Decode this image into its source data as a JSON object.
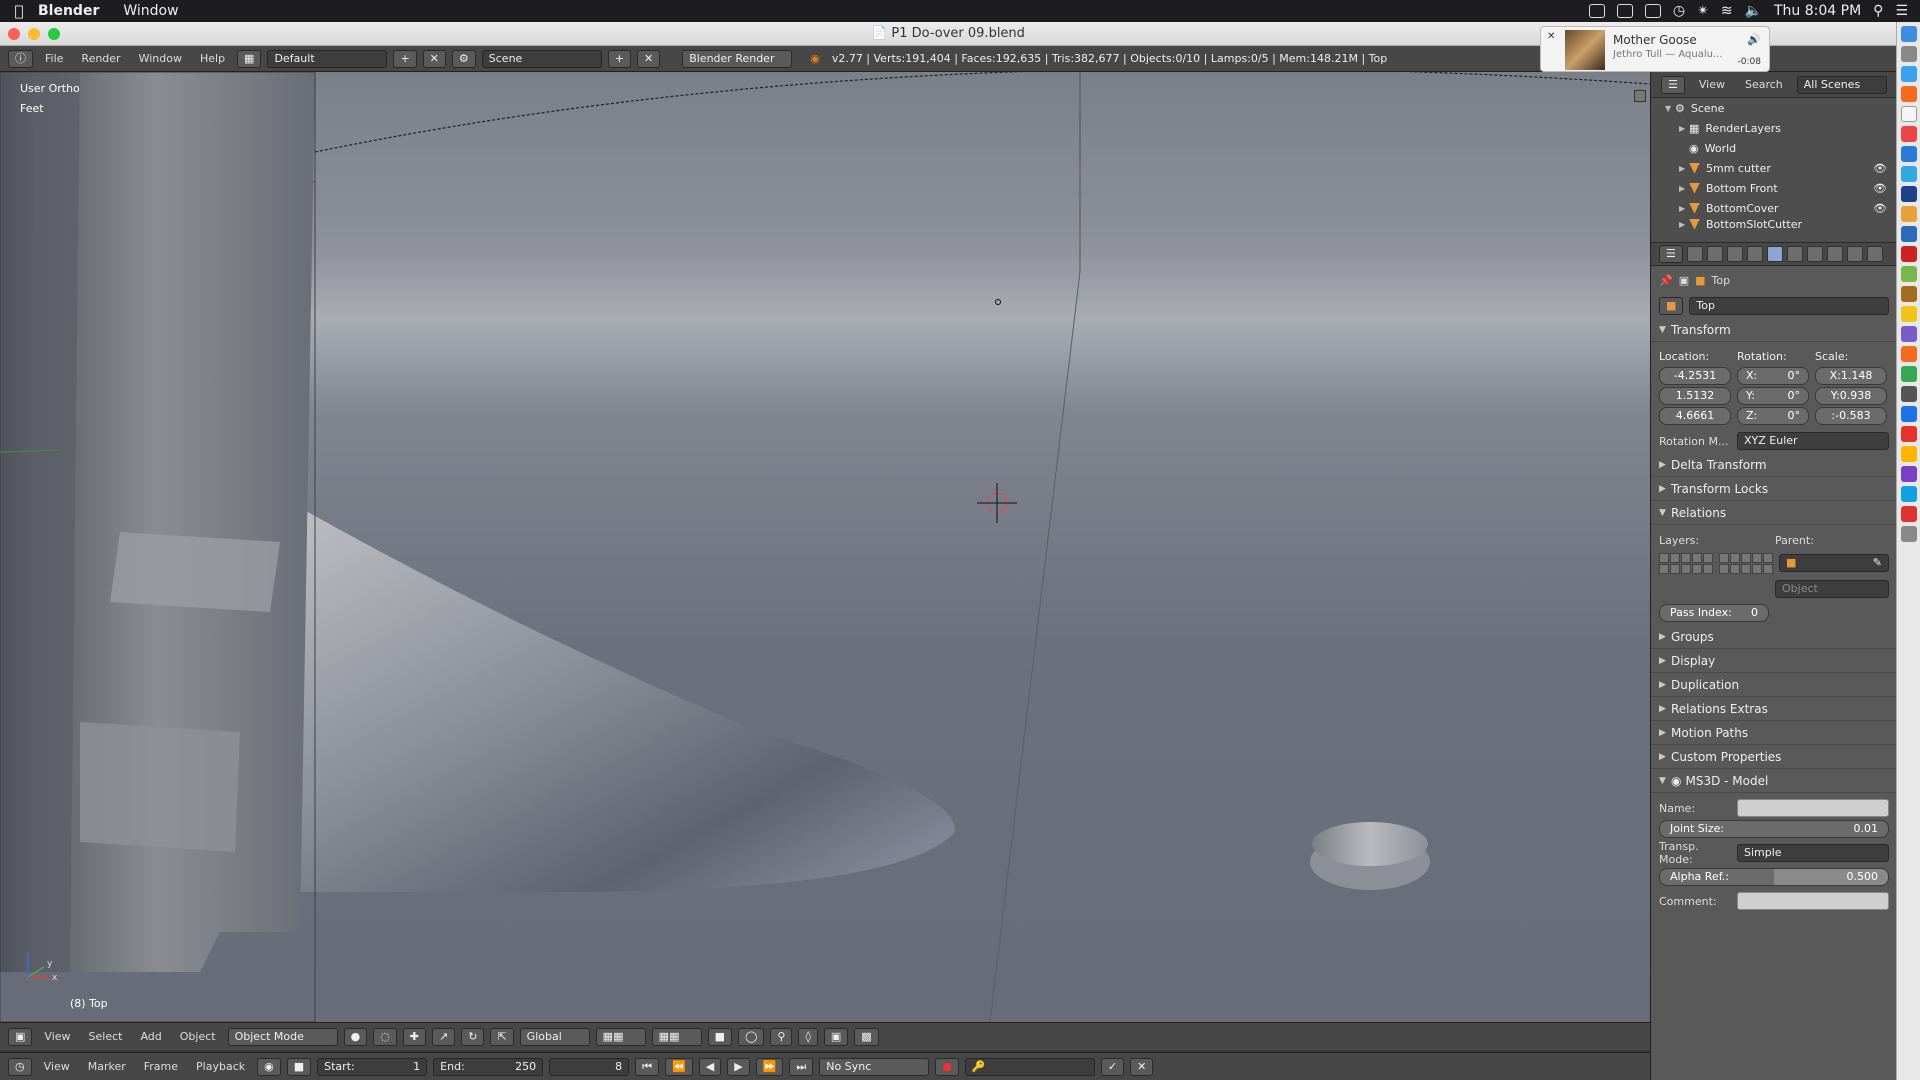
{
  "mac_menubar": {
    "app": "Blender",
    "menu": "Window",
    "clock": "Thu 8:04 PM"
  },
  "window": {
    "title": "P1 Do-over 09.blend"
  },
  "now_playing": {
    "title": "Mother Goose",
    "artist": "Jethro Tull — Aqualu...",
    "time": "-0:08"
  },
  "top_header": {
    "menus": [
      "File",
      "Render",
      "Window",
      "Help"
    ],
    "screen_layout": "Default",
    "scene": "Scene",
    "engine": "Blender Render",
    "stats": "v2.77 | Verts:191,404 | Faces:192,635 | Tris:382,677 | Objects:0/10 | Lamps:0/5 | Mem:148.21M | Top"
  },
  "viewport": {
    "view_name": "User Ortho",
    "units": "Feet",
    "object_label": "(8) Top",
    "axis_x": "x",
    "axis_y": "y"
  },
  "viewport_header": {
    "menus": [
      "View",
      "Select",
      "Add",
      "Object"
    ],
    "mode": "Object Mode",
    "orientation": "Global"
  },
  "timeline_header": {
    "menus": [
      "View",
      "Marker",
      "Frame",
      "Playback"
    ],
    "start_label": "Start:",
    "start": "1",
    "end_label": "End:",
    "end": "250",
    "current": "8",
    "sync": "No Sync"
  },
  "outliner": {
    "menus": [
      "View",
      "Search"
    ],
    "filter": "All Scenes",
    "items": [
      "Scene",
      "RenderLayers",
      "World",
      "5mm cutter",
      "Bottom Front",
      "BottomCover",
      "BottomSlotCutter"
    ]
  },
  "properties": {
    "context_object": "Top",
    "object_name": "Top",
    "transform": {
      "title": "Transform",
      "location_label": "Location:",
      "rotation_label": "Rotation:",
      "scale_label": "Scale:",
      "location": [
        "-4.2531",
        "1.5132",
        "4.6661"
      ],
      "rotation": [
        "X:",
        "0°",
        "Y:",
        "0°",
        "Z:",
        "0°"
      ],
      "scale": [
        "X:1.148",
        "Y:0.938",
        ":-0.583"
      ],
      "rotation_mode_label": "Rotation M...",
      "rotation_mode": "XYZ Euler"
    },
    "panels_collapsed_1": [
      "Delta Transform",
      "Transform Locks"
    ],
    "relations": {
      "title": "Relations",
      "layers_label": "Layers:",
      "parent_label": "Parent:",
      "parent_type": "Object",
      "pass_index_label": "Pass Index:",
      "pass_index": "0"
    },
    "panels_collapsed_2": [
      "Groups",
      "Display",
      "Duplication",
      "Relations Extras",
      "Motion Paths",
      "Custom Properties"
    ],
    "ms3d": {
      "title": "MS3D - Model",
      "name_label": "Name:",
      "joint_size_label": "Joint Size:",
      "joint_size": "0.01",
      "transp_label": "Transp. Mode:",
      "transp_mode": "Simple",
      "alpha_label": "Alpha Ref.:",
      "alpha": "0.500",
      "comment_label": "Comment:"
    }
  }
}
